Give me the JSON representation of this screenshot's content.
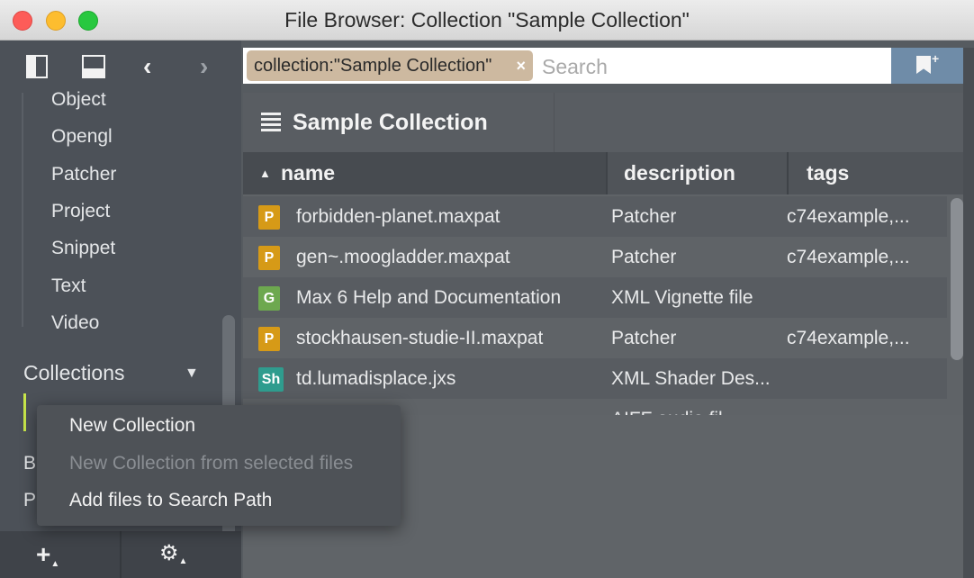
{
  "window": {
    "title": "File Browser: Collection \"Sample Collection\""
  },
  "sidebar": {
    "items": [
      "Object",
      "Opengl",
      "Patcher",
      "Project",
      "Snippet",
      "Text",
      "Video"
    ],
    "section_label": "Collections",
    "partial_items": [
      "B",
      "P"
    ],
    "bottom": {
      "add_label": "+",
      "gear_label": "⚙"
    }
  },
  "search": {
    "token": "collection:\"Sample Collection\"",
    "token_close": "×",
    "placeholder": "Search",
    "value": ""
  },
  "collection": {
    "title": "Sample Collection"
  },
  "table": {
    "columns": [
      "name",
      "description",
      "tags"
    ],
    "sort_column": "name",
    "sort_direction": "ascending",
    "rows": [
      {
        "badge": "P",
        "badge_color": "#d69a17",
        "name": "forbidden-planet.maxpat",
        "description": "Patcher",
        "tags": "c74example,..."
      },
      {
        "badge": "P",
        "badge_color": "#d69a17",
        "name": "gen~.moogladder.maxpat",
        "description": "Patcher",
        "tags": "c74example,..."
      },
      {
        "badge": "G",
        "badge_color": "#6da84f",
        "name": "Max 6 Help and Documentation",
        "description": "XML Vignette file",
        "tags": ""
      },
      {
        "badge": "P",
        "badge_color": "#d69a17",
        "name": "stockhausen-studie-II.maxpat",
        "description": "Patcher",
        "tags": "c74example,..."
      },
      {
        "badge": "Sh",
        "badge_color": "#2f9c8e",
        "name": "td.lumadisplace.jxs",
        "description": "XML Shader Des...",
        "tags": ""
      },
      {
        "badge": "",
        "badge_color": "",
        "name": "",
        "description": "AIFF audio fil...",
        "tags": ""
      }
    ]
  },
  "menu": {
    "items": [
      {
        "label": "New Collection",
        "enabled": true
      },
      {
        "label": "New Collection from selected files",
        "enabled": false
      },
      {
        "label": "Add files to Search Path",
        "enabled": true
      }
    ]
  },
  "colors": {
    "accent_selection": "#c8e64a",
    "search_token": "#cdb9a0",
    "bookmark_button": "#6f8ca8"
  }
}
